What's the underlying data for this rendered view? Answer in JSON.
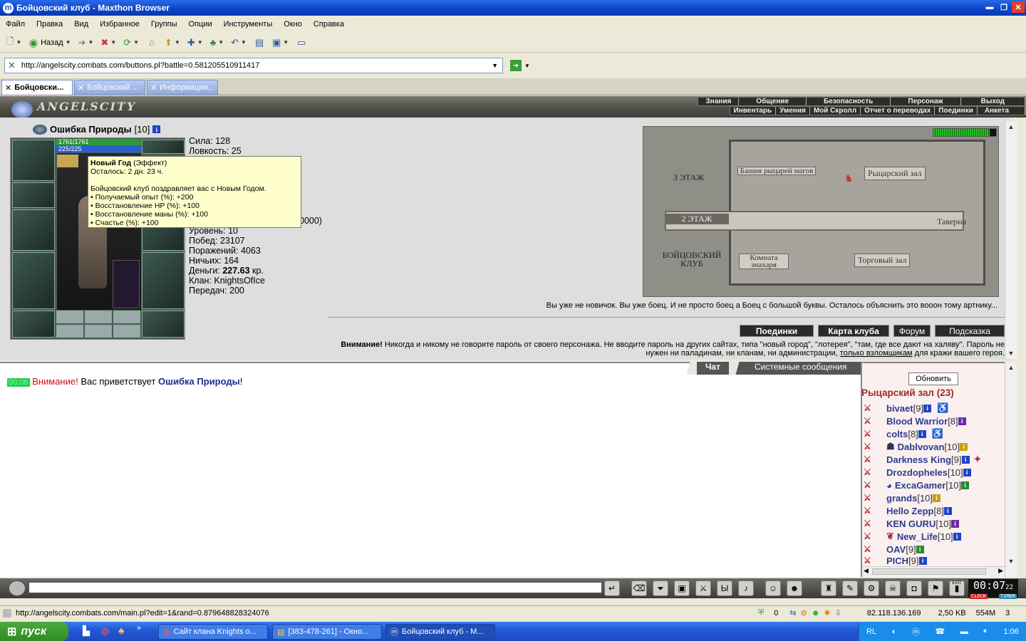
{
  "window": {
    "title": "Бойцовский клуб - Maxthon Browser",
    "logo": "m"
  },
  "menu": [
    "Файл",
    "Правка",
    "Вид",
    "Избранное",
    "Группы",
    "Опции",
    "Инструменты",
    "Окно",
    "Справка"
  ],
  "toolbar": {
    "back_label": "Назад"
  },
  "address": {
    "url": "http://angelscity.combats.com/buttons.pl?battle=0.581205510911417"
  },
  "tabs": [
    "Бойцовски...",
    "Бойцовский ...",
    "Информация..."
  ],
  "game": {
    "logo": "ANGELSCITY",
    "nav_top": [
      "Знания",
      "Общение",
      "Безопасность",
      "Персонаж",
      "Выход"
    ],
    "nav_bottom": [
      "Инвентарь",
      "Умения",
      "Мой Скролл",
      "Отчет о переводах",
      "Поединки",
      "Анкета"
    ],
    "character": {
      "name": "Ошибка Природы",
      "level": "[10]",
      "hp": "1761/1761",
      "mp": "225/225",
      "stats": [
        {
          "label": "Сила: ",
          "value": "128"
        },
        {
          "label": "Ловкость: ",
          "value": "25"
        }
      ],
      "hidden_tail": "0000)",
      "stats2": [
        {
          "label": "Уровень: ",
          "value": "10"
        },
        {
          "label": "Побед: ",
          "value": "23107"
        },
        {
          "label": "Поражений: ",
          "value": "4063"
        },
        {
          "label": "Ничьих: ",
          "value": "164"
        }
      ],
      "money_label": "Деньги: ",
      "money": "227.63",
      "money_unit": " кр.",
      "clan": "Клан: KnightsOfIce",
      "transfers": "Передач: 200"
    },
    "tooltip": {
      "title": "Новый Год",
      "title_suffix": " (Эффект)",
      "remaining": "Осталось: 2 дн. 23 ч.",
      "greeting": "Бойцовский клуб поздравляет вас с Новым Годом.",
      "bonuses": [
        "• Получаемый опыт (%): +200",
        "• Восстановление HP (%): +100",
        "• Восстановление маны (%): +100",
        "• Счастье (%): +100"
      ]
    },
    "map": {
      "rooms": [
        "3 ЭТАЖ",
        "Башня рыцарей магов",
        "Рыцарский зал",
        "2 ЭТАЖ",
        "Таверна",
        "БОЙЦОВСКИЙ КЛУБ",
        "Комната знахаря",
        "Торговый зал"
      ]
    },
    "greeting_msg": "Вы уже не новичок. Вы уже боец. И не просто боец а Боец с большой буквы. Осталось объяснить это вооон тому артнику...",
    "buttons": [
      "Поединки",
      "Карта клуба",
      "Форум",
      "Подсказка"
    ],
    "warning_bold": "Внимание!",
    "warning_text": " Никогда и никому не говорите пароль от своего персонажа. Не вводите пароль на других сайтах, типа \"новый город\", \"лотерея\", \"там, где все дают на халяву\". Пароль не нужен ни паладинам, ни кланам, ни администрации, ",
    "warning_link": "только взломщикам",
    "warning_end": " для кражи вашего героя."
  },
  "chat": {
    "tabs": [
      "Чат",
      "Системные сообщения"
    ],
    "time": "00:06",
    "alert": "Внимание!",
    "text": " Вас приветствует ",
    "name": "Ошибка Природы",
    "end": "!"
  },
  "online": {
    "refresh": "Обновить",
    "room": "Рыцарский зал (23)",
    "users": [
      {
        "name": "bivaet",
        "level": "[9]"
      },
      {
        "name": "Blood Warrior",
        "level": "[8]"
      },
      {
        "name": "colts",
        "level": "[8]"
      },
      {
        "name": "Dablvovan",
        "level": "[10]"
      },
      {
        "name": "Darkness King",
        "level": "[9]"
      },
      {
        "name": "Drozdopheles",
        "level": "[10]"
      },
      {
        "name": "ExcaGamer",
        "level": "[10]"
      },
      {
        "name": "grands",
        "level": "[10]"
      },
      {
        "name": "Hello Zepp",
        "level": "[8]"
      },
      {
        "name": "KEN GURU",
        "level": "[10]"
      },
      {
        "name": "New_Life",
        "level": "[10]"
      },
      {
        "name": "OAV",
        "level": "[9]"
      },
      {
        "name": "PICH",
        "level": "[9]"
      }
    ]
  },
  "clock": {
    "time": "00:07",
    "sec": "22",
    "labels": [
      "CLOCK",
      "TIMER"
    ],
    "exit": "EXIT"
  },
  "statusbar": {
    "url": "http://angelscity.combats.com/main.pl?edit=1&rand=0.879648828324076",
    "count": "0",
    "ip": "82.118.136.169",
    "size": "2,50 KB",
    "mem": "554M",
    "num": "3"
  },
  "taskbar": {
    "start": "пуск",
    "tasks": [
      "Сайт клана Knights o...",
      "[383-478-261] - Окно...",
      "Бойцовский клуб - M..."
    ],
    "lang": "RL",
    "time": "1:06"
  }
}
